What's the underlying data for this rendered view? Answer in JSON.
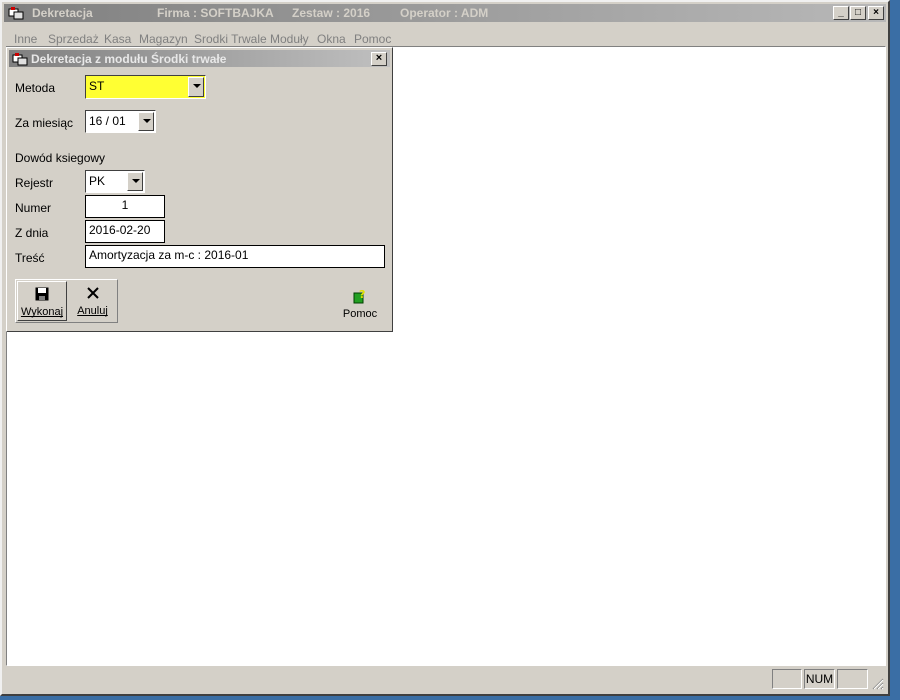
{
  "window": {
    "title": "Dekretacja",
    "firma": "Firma : SOFTBAJKA",
    "zestaw": "Zestaw : 2016",
    "operator": "Operator : ADM",
    "minimize": "_",
    "maximize": "□",
    "close": "×"
  },
  "menu": [
    "Inne",
    "Sprzedaż",
    "Kasa",
    "Magazyn",
    "Srodki Trwale",
    "Moduły",
    "Okna",
    "Pomoc"
  ],
  "dialog": {
    "title": "Dekretacja z modułu Środki trwałe",
    "close": "×",
    "metoda_label": "Metoda",
    "metoda_value": "ST",
    "miesiac_label": "Za miesiąc",
    "miesiac_value": "16 / 01",
    "dowod_label": "Dowód ksiegowy",
    "rejestr_label": "Rejestr",
    "rejestr_value": "PK",
    "numer_label": "Numer",
    "numer_value": "1",
    "zdnia_label": "Z dnia",
    "zdnia_value": "2016-02-20",
    "tresc_label": "Treść",
    "tresc_value": "Amortyzacja za m-c : 2016-01",
    "wykonaj_label": "Wykonaj",
    "anuluj_label": "Anuluj",
    "pomoc_label": "Pomoc"
  },
  "status": {
    "num": "NUM"
  },
  "colors": {
    "highlight_field": "#ffff33",
    "face": "#d4d0c8",
    "desktop": "#3a6ea5"
  }
}
